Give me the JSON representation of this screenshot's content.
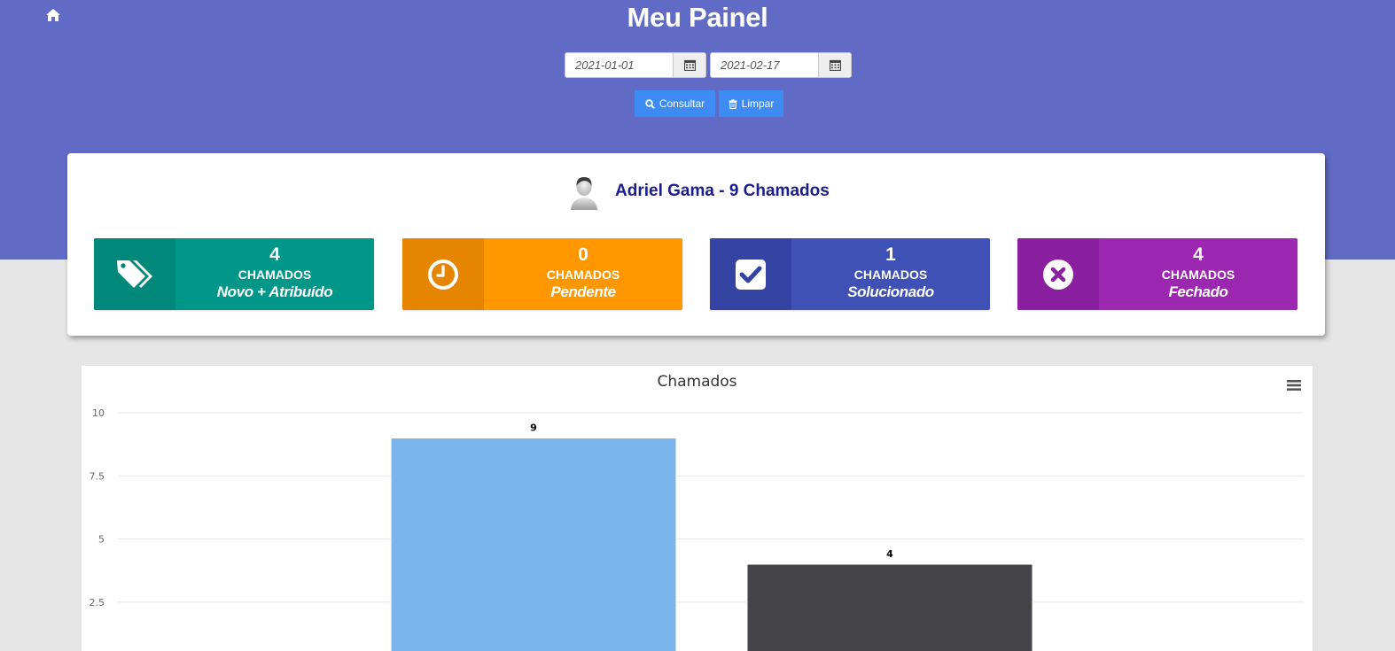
{
  "header": {
    "title": "Meu Painel",
    "date_from": "2021-01-01",
    "date_to": "2021-02-17",
    "consult_label": "Consultar",
    "clear_label": "Limpar"
  },
  "user": {
    "heading": "Adriel Gama - 9 Chamados"
  },
  "stats": [
    {
      "count": "4",
      "label": "CHAMADOS",
      "status": "Novo + Atribuído",
      "icon": "tags-icon",
      "color": "#009688",
      "icon_bg": "#00897b"
    },
    {
      "count": "0",
      "label": "CHAMADOS",
      "status": "Pendente",
      "icon": "clock-icon",
      "color": "#ff9800",
      "icon_bg": "#e68600"
    },
    {
      "count": "1",
      "label": "CHAMADOS",
      "status": "Solucionado",
      "icon": "check-square-icon",
      "color": "#3f51b5",
      "icon_bg": "#3544a3"
    },
    {
      "count": "4",
      "label": "CHAMADOS",
      "status": "Fechado",
      "icon": "close-circle-icon",
      "color": "#9c27b0",
      "icon_bg": "#8a1fa0"
    }
  ],
  "chart_data": {
    "type": "bar",
    "title": "Chamados",
    "categories": [
      "",
      ""
    ],
    "values": [
      9,
      4
    ],
    "colors": [
      "#7cb5ec",
      "#434348"
    ],
    "data_labels": [
      "9",
      "4"
    ],
    "ylim": [
      0,
      10
    ],
    "yticks": [
      "10",
      "7.5",
      "5",
      "2.5"
    ],
    "grid": true
  }
}
